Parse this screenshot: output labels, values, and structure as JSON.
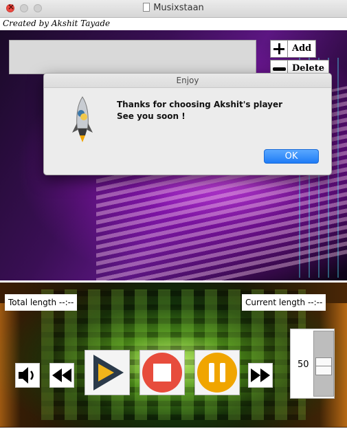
{
  "window": {
    "title": "Musixstaan"
  },
  "credit": "Created by Akshit Tayade",
  "playlist": {
    "add_label": "Add",
    "delete_label": "Delete"
  },
  "status": {
    "total_length": "Total length --:--",
    "current_length": "Current length --:--"
  },
  "volume": {
    "value": "50"
  },
  "dialog": {
    "title": "Enjoy",
    "line1": "Thanks for choosing Akshit's player",
    "line2": "See you soon !",
    "ok_label": "OK"
  },
  "colors": {
    "accent_blue": "#1f7cf6",
    "play_triangle": "#2b3a4a",
    "play_fill": "#f0b41a",
    "stop_red": "#e74c3c",
    "pause_yellow": "#f0a500"
  },
  "icons": [
    "close-window-icon",
    "minimize-window-icon",
    "maximize-window-icon",
    "document-icon",
    "plus-icon",
    "minus-icon",
    "speaker-icon",
    "rewind-icon",
    "play-icon",
    "stop-icon",
    "pause-icon",
    "fast-forward-icon",
    "python-rocket-icon"
  ]
}
